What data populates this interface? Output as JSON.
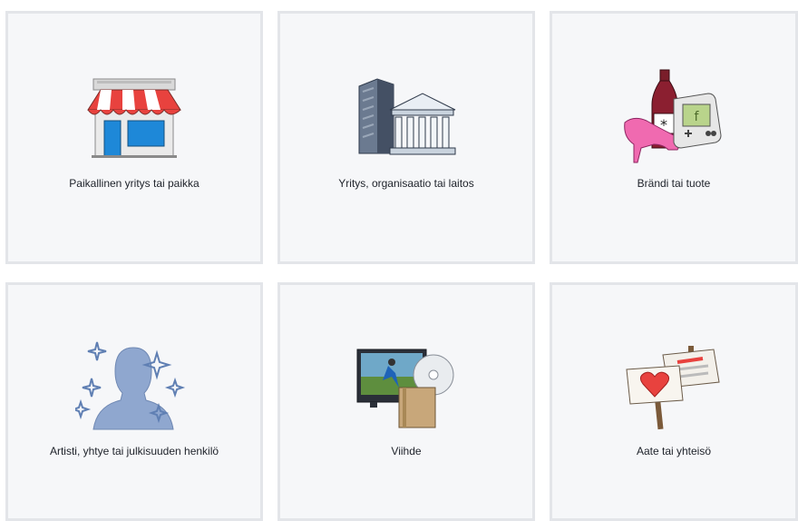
{
  "categories": [
    {
      "label": "Paikallinen yritys tai paikka",
      "icon": "storefront-icon"
    },
    {
      "label": "Yritys, organisaatio tai laitos",
      "icon": "buildings-icon"
    },
    {
      "label": "Brändi tai tuote",
      "icon": "products-icon"
    },
    {
      "label": "Artisti, yhtye tai julkisuuden henkilö",
      "icon": "person-silhouette-icon"
    },
    {
      "label": "Viihde",
      "icon": "entertainment-icon"
    },
    {
      "label": "Aate tai yhteisö",
      "icon": "signs-icon"
    }
  ],
  "colors": {
    "tile_bg": "#f6f7f9",
    "tile_border": "#e3e5e9",
    "text": "#1d2129"
  }
}
